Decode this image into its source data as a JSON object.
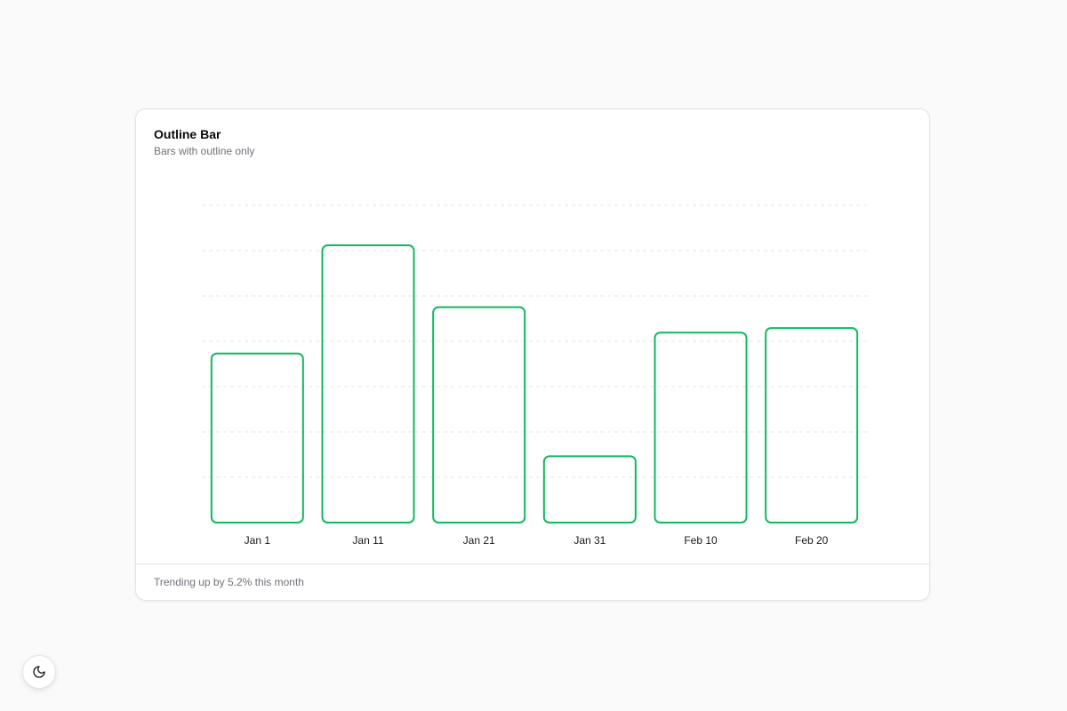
{
  "card": {
    "title": "Outline Bar",
    "description": "Bars with outline only",
    "footer": "Trending up by 5.2% this month"
  },
  "theme_toggle": {
    "icon": "moon-icon"
  },
  "colors": {
    "bar_stroke": "#10b95f",
    "grid": "#e4e4e7"
  },
  "chart_data": {
    "type": "bar",
    "style": "outline",
    "categories": [
      "Jan 1",
      "Jan 11",
      "Jan 21",
      "Jan 31",
      "Feb 10",
      "Feb 20"
    ],
    "values": [
      186,
      305,
      237,
      73,
      209,
      214
    ],
    "ylim": [
      0,
      350
    ],
    "grid": true,
    "legend": "none"
  }
}
